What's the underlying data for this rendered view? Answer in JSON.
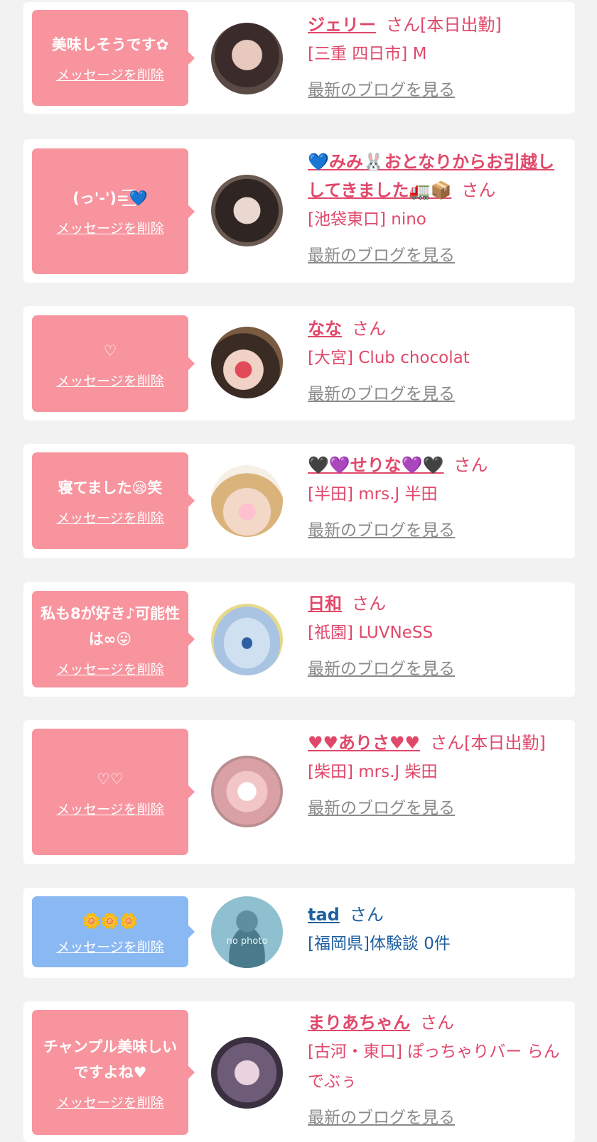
{
  "cards": [
    {
      "message": "美味しそうです✿",
      "delete_label": "メッセージを削除",
      "name": "ジェリー",
      "suffix": "さん[本日出勤]",
      "shop": "[三重 四日市] M",
      "blog_label": "最新のブログを見る"
    },
    {
      "message": "(っ'-')=͟͟͞͞💙",
      "delete_label": "メッセージを削除",
      "name": "💙みみ🐰おとなりからお引越ししてきました🚛📦",
      "suffix": "さん",
      "shop": "[池袋東口] nino",
      "blog_label": "最新のブログを見る"
    },
    {
      "message": "♡",
      "delete_label": "メッセージを削除",
      "name": "なな",
      "suffix": "さん",
      "shop": "[大宮] Club chocolat",
      "blog_label": "最新のブログを見る"
    },
    {
      "message": "寝てました😪笑",
      "delete_label": "メッセージを削除",
      "name": "🖤💜せりな💜🖤",
      "suffix": "さん",
      "shop": "[半田] mrs.J 半田",
      "blog_label": "最新のブログを見る"
    },
    {
      "message": "私も8が好き♪可能性は∞😛",
      "delete_label": "メッセージを削除",
      "name": "日和",
      "suffix": "さん",
      "shop": "[祇園] LUVNeSS",
      "blog_label": "最新のブログを見る"
    },
    {
      "message": "♡♡",
      "delete_label": "メッセージを削除",
      "name": "♥♥ありさ♥♥",
      "suffix": "さん[本日出勤]",
      "shop": "[柴田] mrs.J 柴田",
      "blog_label": "最新のブログを見る"
    },
    {
      "message": "🌼🌼🌼",
      "delete_label": "メッセージを削除",
      "name": "tad",
      "suffix": "さん",
      "shop": "[福岡県]体験談 0件",
      "avatar_text": "no photo"
    },
    {
      "message": "チャンプル美味しいですよね♥",
      "delete_label": "メッセージを削除",
      "name": "まりあちゃん",
      "suffix": "さん",
      "shop": "[古河・東口] ぽっちゃりバー らんでぶぅ",
      "blog_label": "最新のブログを見る"
    }
  ],
  "colors": {
    "pink_bubble": "#f7949e",
    "blue_bubble": "#8ab8f2",
    "pink_text": "#e0486a",
    "blue_text": "#1e5f9f",
    "link_gray": "#8a8a8a"
  },
  "icons": [
    "avatar-photo",
    "no-photo-avatar"
  ]
}
